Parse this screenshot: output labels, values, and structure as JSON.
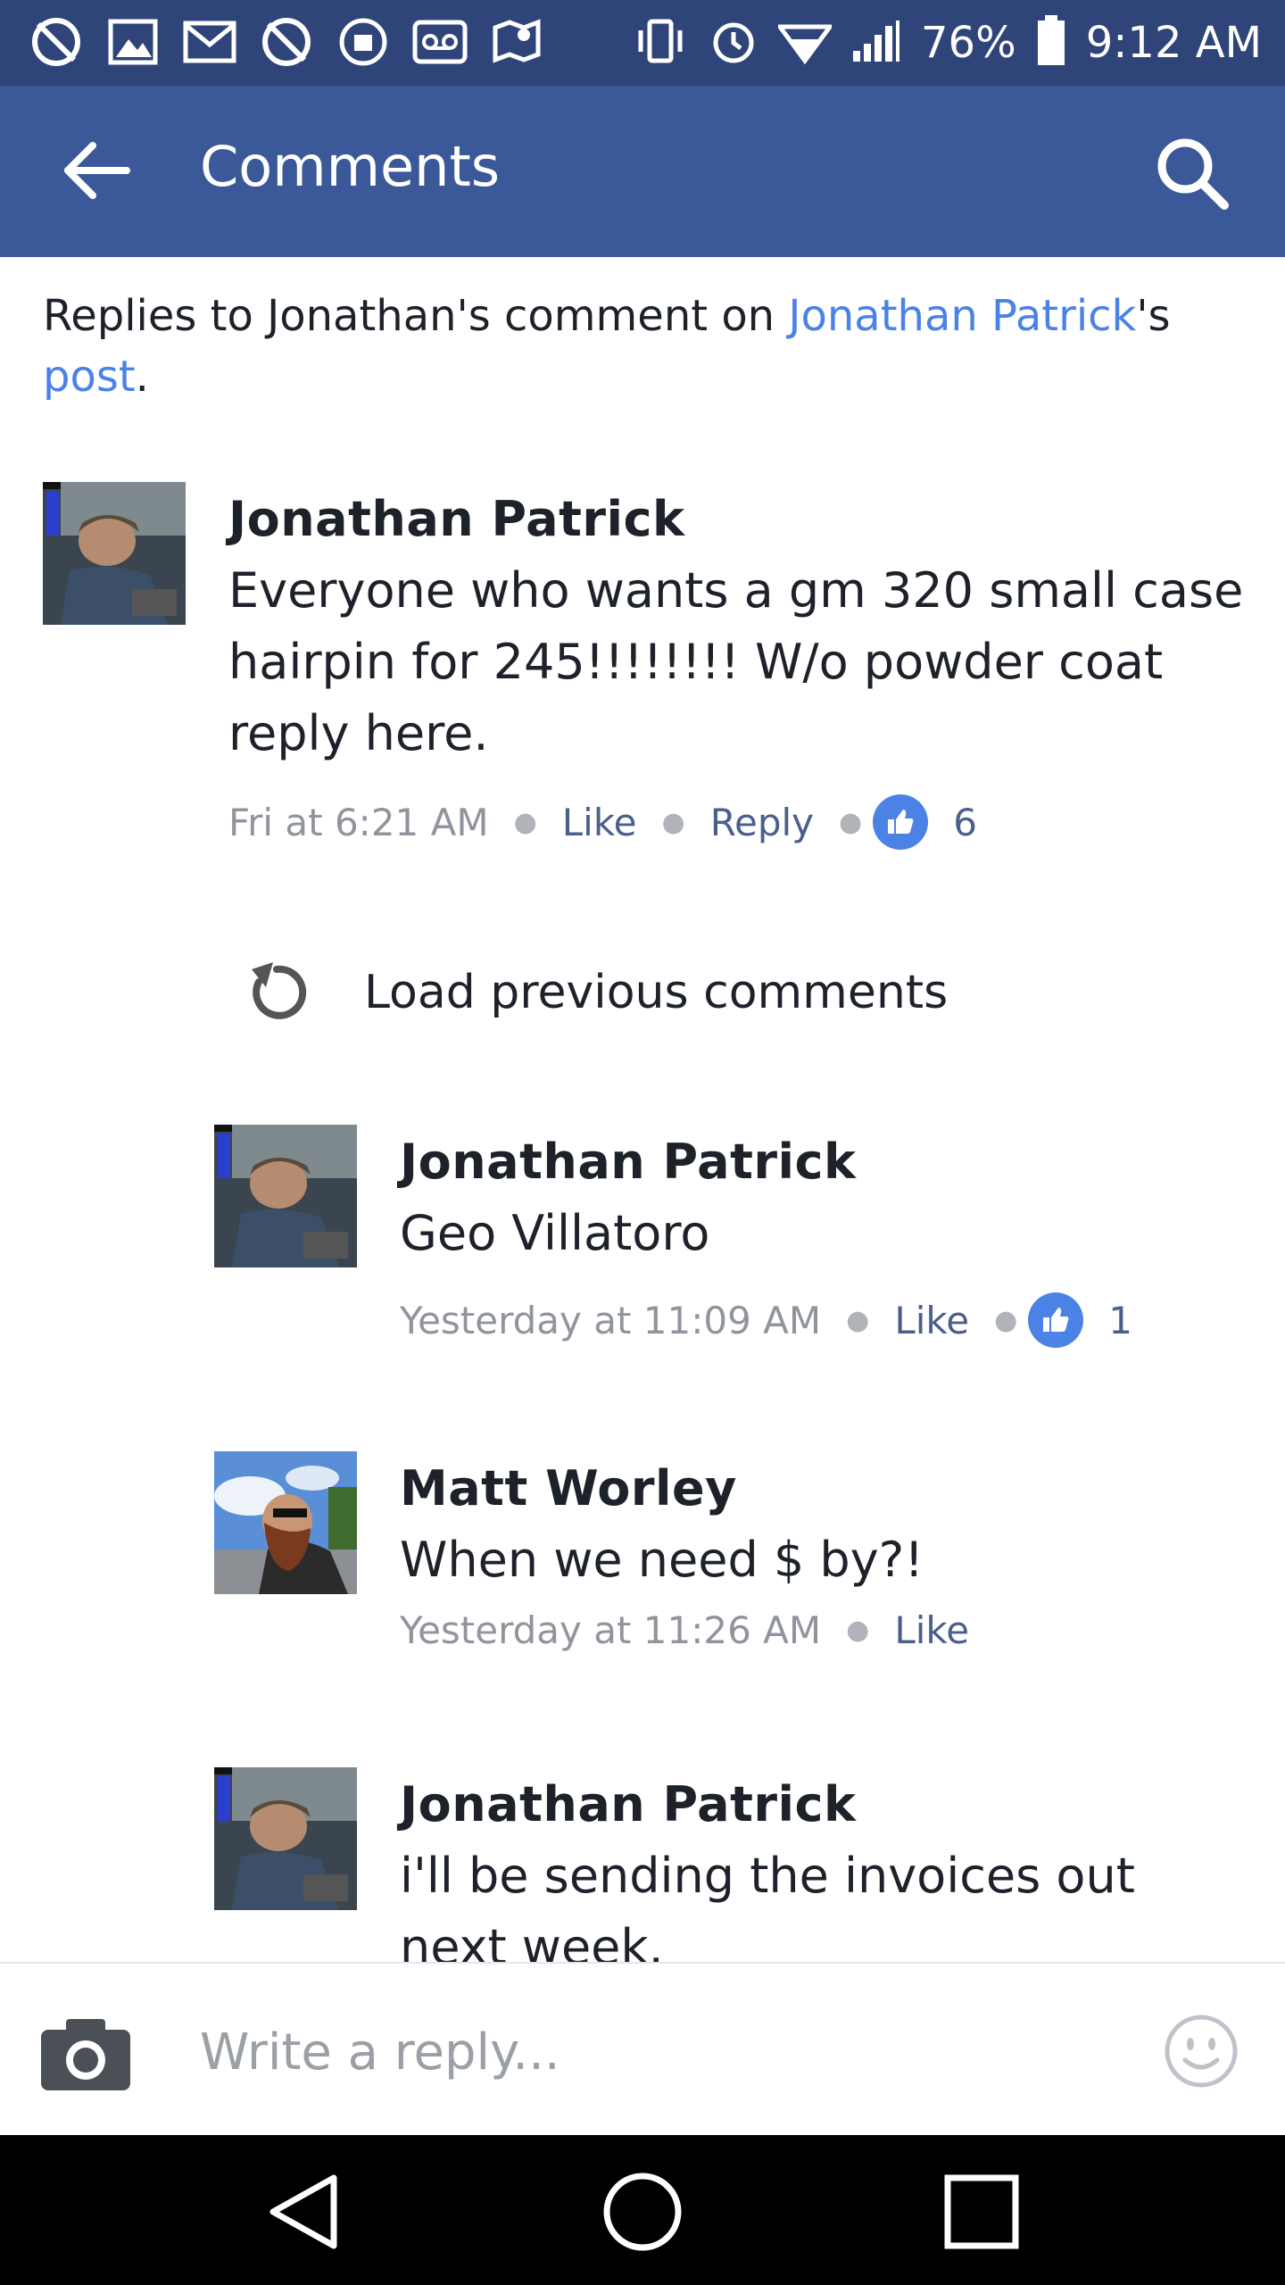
{
  "status_bar": {
    "battery": "76%",
    "time": "9:12 AM",
    "left_icons": [
      "no-location-icon",
      "photo-icon",
      "gmail-icon",
      "no-location-icon",
      "android-icon",
      "voicemail-icon",
      "maps-icon"
    ],
    "right_icons": [
      "vibrate-icon",
      "alarm-icon",
      "wifi-icon",
      "signal-icon",
      "battery-icon"
    ]
  },
  "app_bar": {
    "title": "Comments"
  },
  "intro": {
    "prefix": "Replies to Jonathan's comment on ",
    "author_link": "Jonathan Patrick",
    "possessive": "'s",
    "post_link": "post",
    "suffix": "."
  },
  "root_comment": {
    "author": "Jonathan Patrick",
    "text": "Everyone who wants a gm 320 small case hairpin for 245!!!!!!!! W/o powder coat reply here.",
    "time": "Fri at 6:21 AM",
    "like_label": "Like",
    "reply_label": "Reply",
    "likes": "6"
  },
  "load_previous": {
    "label": "Load previous comments"
  },
  "replies": [
    {
      "author": "Jonathan Patrick",
      "text": "Geo Villatoro",
      "time": "Yesterday at 11:09 AM",
      "like_label": "Like",
      "likes": "1"
    },
    {
      "author": "Matt Worley",
      "text": "When we need $ by?!",
      "time": "Yesterday at 11:26 AM",
      "like_label": "Like"
    },
    {
      "author": "Jonathan Patrick",
      "text": "i'll be sending the invoices out next week."
    }
  ],
  "composer": {
    "placeholder": "Write a reply..."
  },
  "colors": {
    "status_bar": "#2f4479",
    "app_bar": "#3b5898",
    "link": "#4b82e6",
    "action": "#4b5f8c"
  }
}
